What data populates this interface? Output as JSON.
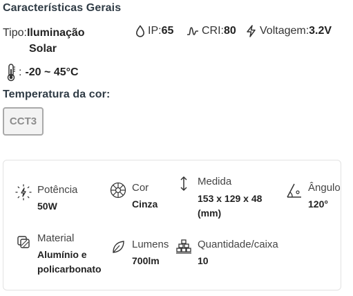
{
  "general": {
    "title": "Características Gerais",
    "tipo_label": "Tipo:",
    "tipo_value_line1": "Iluminação",
    "tipo_value_line2": "Solar",
    "ip_label": "IP:",
    "ip_value": "65",
    "cri_label": "CRI:",
    "cri_value": "80",
    "volt_label": "Voltagem:",
    "volt_value": "3.2V",
    "temp_separator": ":",
    "temp_value": "-20 ~ 45°C"
  },
  "color_temp": {
    "title": "Temperatura da cor:",
    "option": "CCT3"
  },
  "specs": {
    "potencia_label": "Potência",
    "potencia_value": "50W",
    "cor_label": "Cor",
    "cor_value": "Cinza",
    "medida_label": "Medida",
    "medida_value_line1": "153 x 129 x 48",
    "medida_value_line2": "(mm)",
    "angulo_label": "Ângulo",
    "angulo_value": "120°",
    "material_label": "Material",
    "material_value_line1": "Alumínio e",
    "material_value_line2": "policarbonato",
    "lumens_label": "Lumens",
    "lumens_value": "700lm",
    "quantidade_label": "Quantidade/caixa",
    "quantidade_value": "10"
  }
}
